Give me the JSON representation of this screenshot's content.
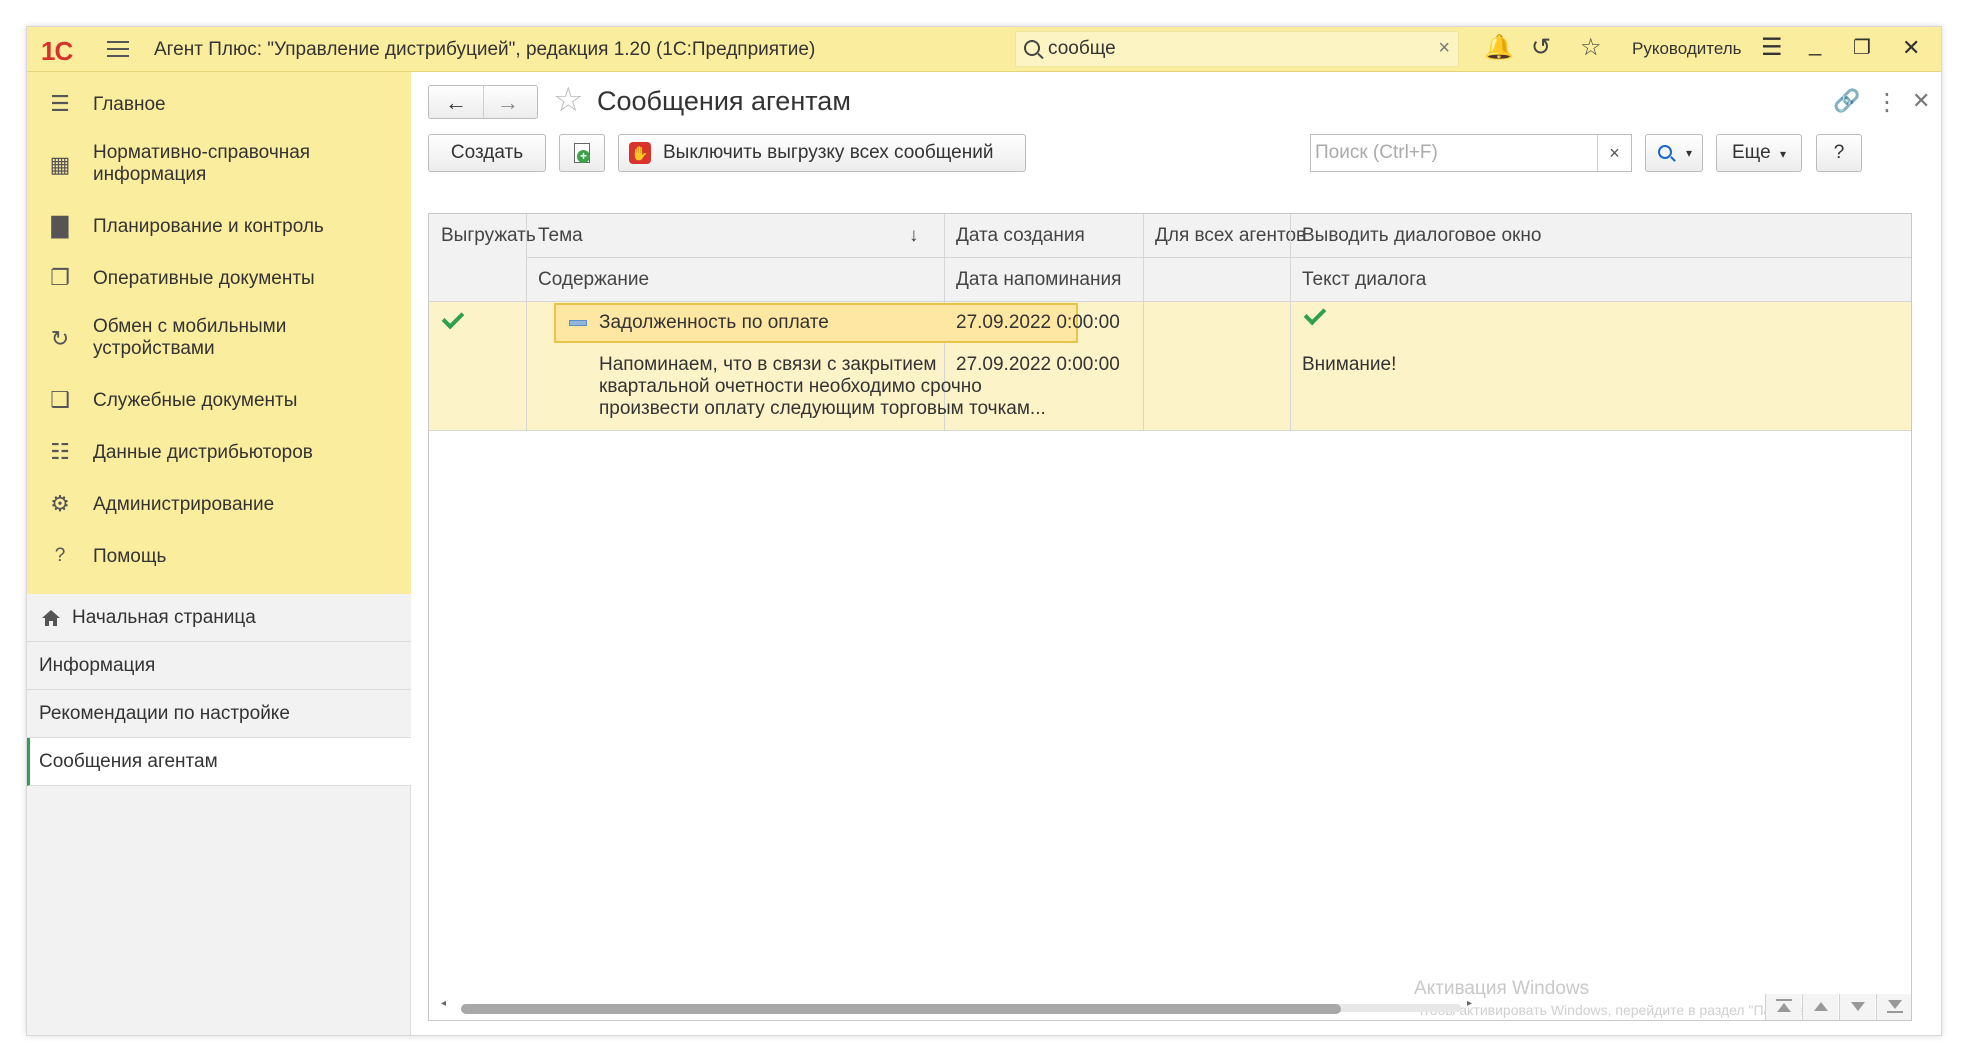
{
  "titlebar": {
    "logo": "1С",
    "app_title": "Агент Плюс: \"Управление дистрибуцией\", редакция 1.20  (1С:Предприятие)",
    "search_value": "сообще",
    "user": "Руководитель",
    "icons": [
      "bell-icon",
      "history-icon",
      "star-icon",
      "settings-icon",
      "minimize-icon",
      "restore-icon",
      "close-icon"
    ]
  },
  "sidebar": {
    "sections": [
      {
        "label": "Главное",
        "icon": "menu-icon"
      },
      {
        "label": "Нормативно-справочная информация",
        "icon": "catalog-icon"
      },
      {
        "label": "Планирование и контроль",
        "icon": "chart-icon"
      },
      {
        "label": "Оперативные документы",
        "icon": "documents-icon"
      },
      {
        "label": "Обмен с мобильными устройствами",
        "icon": "sync-icon"
      },
      {
        "label": "Служебные документы",
        "icon": "service-docs-icon"
      },
      {
        "label": "Данные дистрибьюторов",
        "icon": "distributors-icon"
      },
      {
        "label": "Администрирование",
        "icon": "gear-icon"
      },
      {
        "label": "Помощь",
        "icon": "help-icon"
      }
    ],
    "open_windows": [
      {
        "label": "Начальная страница",
        "active": false
      },
      {
        "label": "Информация",
        "active": false
      },
      {
        "label": "Рекомендации по настройке",
        "active": false
      },
      {
        "label": "Сообщения агентам",
        "active": true
      }
    ]
  },
  "form": {
    "title": "Сообщения агентам",
    "buttons": {
      "create": "Создать",
      "disable_all": "Выключить выгрузку всех сообщений",
      "more": "Еще",
      "help": "?"
    },
    "search_placeholder": "Поиск (Ctrl+F)"
  },
  "table": {
    "columns_row1": [
      "Выгружать",
      "Тема",
      "Дата создания",
      "Для всех агентов",
      "Выводить диалоговое окно"
    ],
    "columns_row2": [
      "Содержание",
      "Дата напоминания",
      "Текст диалога"
    ],
    "sort_indicator": "↓",
    "rows": [
      {
        "upload": true,
        "topic": "Задолженность по оплате",
        "content_lines": [
          "Напоминаем, что в связи с закрытием",
          "квартальной очетности необходимо срочно",
          "произвести оплату следующим торговым точкам..."
        ],
        "created": "27.09.2022 0:00:00",
        "reminder": "27.09.2022 0:00:00",
        "for_all_agents": false,
        "show_dialog": true,
        "dialog_text": "Внимание!"
      }
    ]
  },
  "watermark": {
    "title": "Активация Windows",
    "subtitle": "Чтобы активировать Windows, перейдите в раздел \"Параметры\"."
  },
  "scroll": {
    "horizontal_fraction": 0.88
  }
}
